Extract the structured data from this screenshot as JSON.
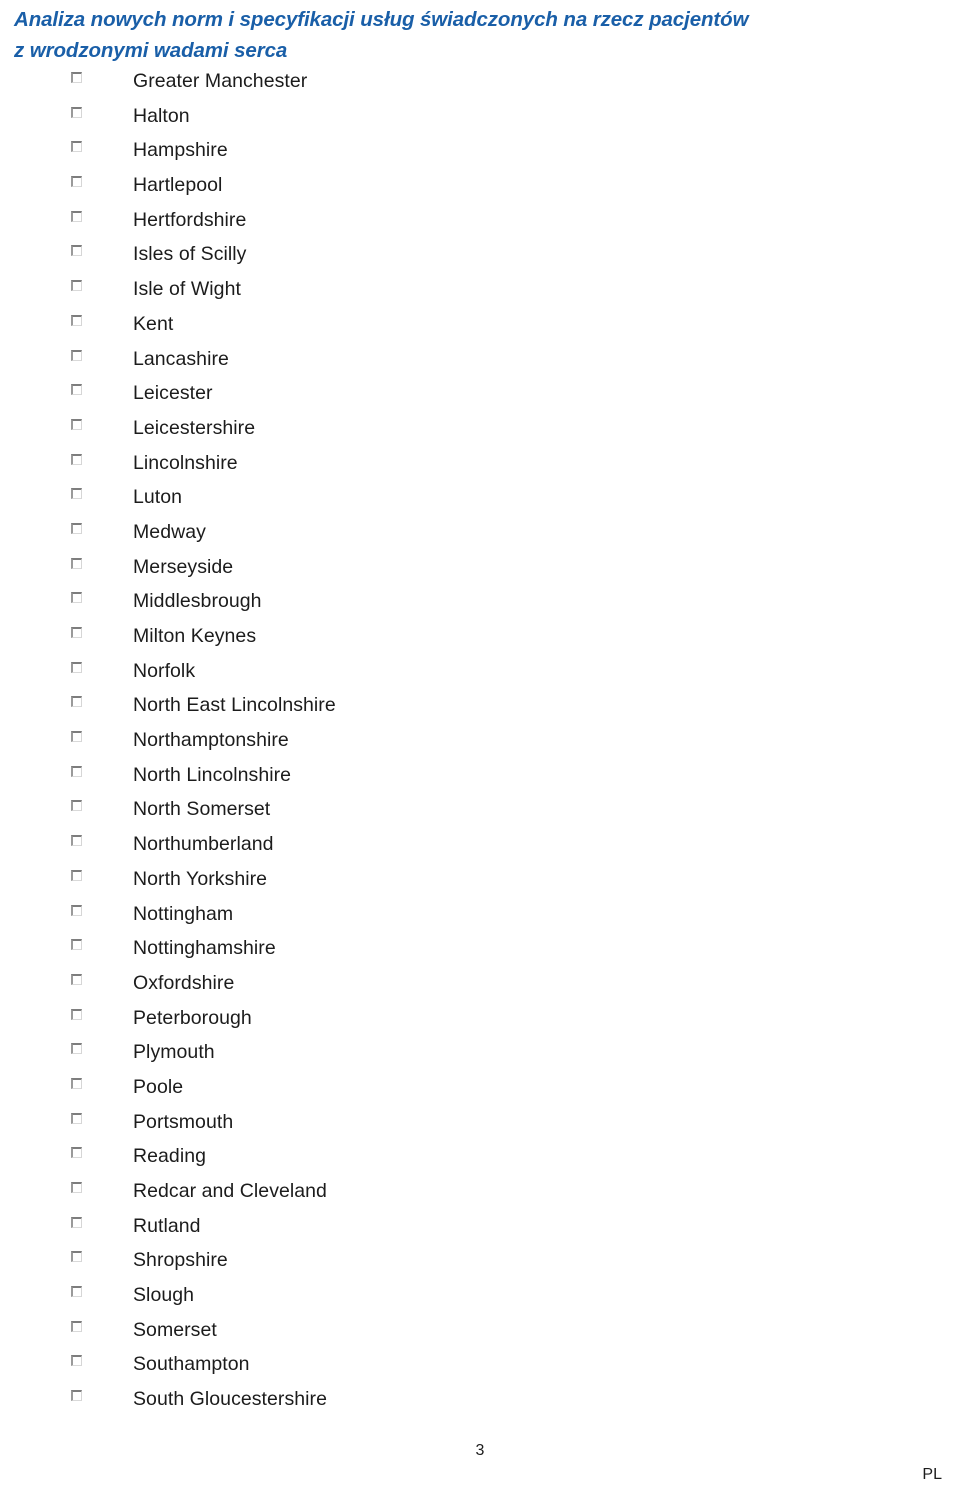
{
  "document": {
    "title": "Analiza nowych norm i specyfikacji usług świadczonych na rzecz pacjentów\nz wrodzonymi wadami serca",
    "title_color": "#1a5fa8",
    "page_number": "3",
    "language_marker": "PL"
  },
  "checkbox_list": {
    "checkbox_state": "unchecked",
    "items": [
      {
        "label": "Greater Manchester",
        "checked": false
      },
      {
        "label": "Halton",
        "checked": false
      },
      {
        "label": "Hampshire",
        "checked": false
      },
      {
        "label": "Hartlepool",
        "checked": false
      },
      {
        "label": "Hertfordshire",
        "checked": false
      },
      {
        "label": "Isles of Scilly",
        "checked": false
      },
      {
        "label": "Isle of Wight",
        "checked": false
      },
      {
        "label": "Kent",
        "checked": false
      },
      {
        "label": "Lancashire",
        "checked": false
      },
      {
        "label": "Leicester",
        "checked": false
      },
      {
        "label": "Leicestershire",
        "checked": false
      },
      {
        "label": "Lincolnshire",
        "checked": false
      },
      {
        "label": "Luton",
        "checked": false
      },
      {
        "label": "Medway",
        "checked": false
      },
      {
        "label": "Merseyside",
        "checked": false
      },
      {
        "label": "Middlesbrough",
        "checked": false
      },
      {
        "label": "Milton Keynes",
        "checked": false
      },
      {
        "label": "Norfolk",
        "checked": false
      },
      {
        "label": "North East Lincolnshire",
        "checked": false
      },
      {
        "label": "Northamptonshire",
        "checked": false
      },
      {
        "label": "North Lincolnshire",
        "checked": false
      },
      {
        "label": "North Somerset",
        "checked": false
      },
      {
        "label": "Northumberland",
        "checked": false
      },
      {
        "label": "North Yorkshire",
        "checked": false
      },
      {
        "label": "Nottingham",
        "checked": false
      },
      {
        "label": "Nottinghamshire",
        "checked": false
      },
      {
        "label": "Oxfordshire",
        "checked": false
      },
      {
        "label": "Peterborough",
        "checked": false
      },
      {
        "label": "Plymouth",
        "checked": false
      },
      {
        "label": "Poole",
        "checked": false
      },
      {
        "label": "Portsmouth",
        "checked": false
      },
      {
        "label": "Reading",
        "checked": false
      },
      {
        "label": "Redcar and Cleveland",
        "checked": false
      },
      {
        "label": "Rutland",
        "checked": false
      },
      {
        "label": "Shropshire",
        "checked": false
      },
      {
        "label": "Slough",
        "checked": false
      },
      {
        "label": "Somerset",
        "checked": false
      },
      {
        "label": "Southampton",
        "checked": false
      },
      {
        "label": "South Gloucestershire",
        "checked": false
      }
    ]
  }
}
